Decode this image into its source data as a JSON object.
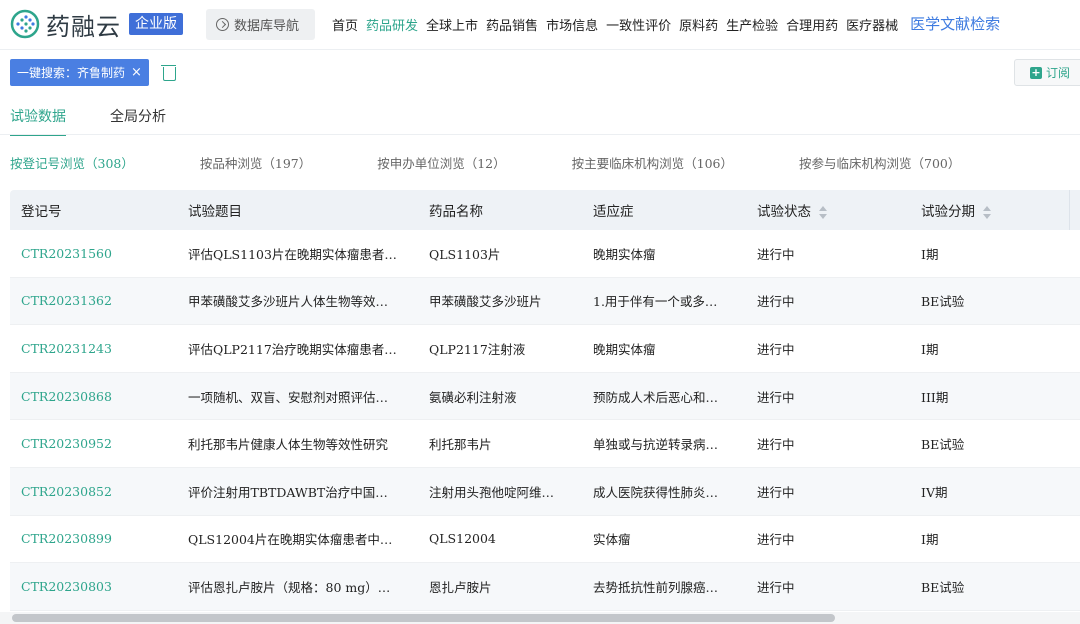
{
  "header": {
    "app_name": "药融云",
    "badge": "企业版",
    "nav_button": "数据库导航",
    "menu": [
      "首页",
      "药品研发",
      "全球上市",
      "药品销售",
      "市场信息",
      "一致性评价",
      "原料药",
      "生产检验",
      "合理用药",
      "医疗器械"
    ],
    "active_menu": "药品研发",
    "literature_link": "医学文献检索"
  },
  "filter": {
    "tag_label": "一键搜索：齐鲁制药",
    "remove": "×",
    "subscribe": "订阅"
  },
  "tabs": [
    "试验数据",
    "全局分析"
  ],
  "browse_by": [
    "按登记号浏览（308）",
    "按品种浏览（197）",
    "按申办单位浏览（12）",
    "按主要临床机构浏览（106）",
    "按参与临床机构浏览（700）"
  ],
  "table": {
    "columns": [
      "登记号",
      "试验题目",
      "药品名称",
      "适应症",
      "试验状态",
      "试验分期"
    ],
    "rows": [
      [
        "CTR20231560",
        "评估QLS1103片在晚期实体瘤患者…",
        "QLS1103片",
        "晚期实体瘤",
        "进行中",
        "I期"
      ],
      [
        "CTR20231362",
        "甲苯磺酸艾多沙班片人体生物等效…",
        "甲苯磺酸艾多沙班片",
        "1.用于伴有一个或多…",
        "进行中",
        "BE试验"
      ],
      [
        "CTR20231243",
        "评估QLP2117治疗晚期实体瘤患者…",
        "QLP2117注射液",
        "晚期实体瘤",
        "进行中",
        "I期"
      ],
      [
        "CTR20230868",
        "一项随机、双盲、安慰剂对照评估…",
        "氨磺必利注射液",
        "预防成人术后恶心和…",
        "进行中",
        "III期"
      ],
      [
        "CTR20230952",
        "利托那韦片健康人体生物等效性研究",
        "利托那韦片",
        "单独或与抗逆转录病…",
        "进行中",
        "BE试验"
      ],
      [
        "CTR20230852",
        "评价注射用TBTDAWBT治疗中国…",
        "注射用头孢他啶阿维…",
        "成人医院获得性肺炎…",
        "进行中",
        "IV期"
      ],
      [
        "CTR20230899",
        "QLS12004片在晚期实体瘤患者中…",
        "QLS12004",
        "实体瘤",
        "进行中",
        "I期"
      ],
      [
        "CTR20230803",
        "评估恩扎卢胺片（规格：80 mg）…",
        "恩扎卢胺片",
        "去势抵抗性前列腺癌…",
        "进行中",
        "BE试验"
      ]
    ]
  }
}
